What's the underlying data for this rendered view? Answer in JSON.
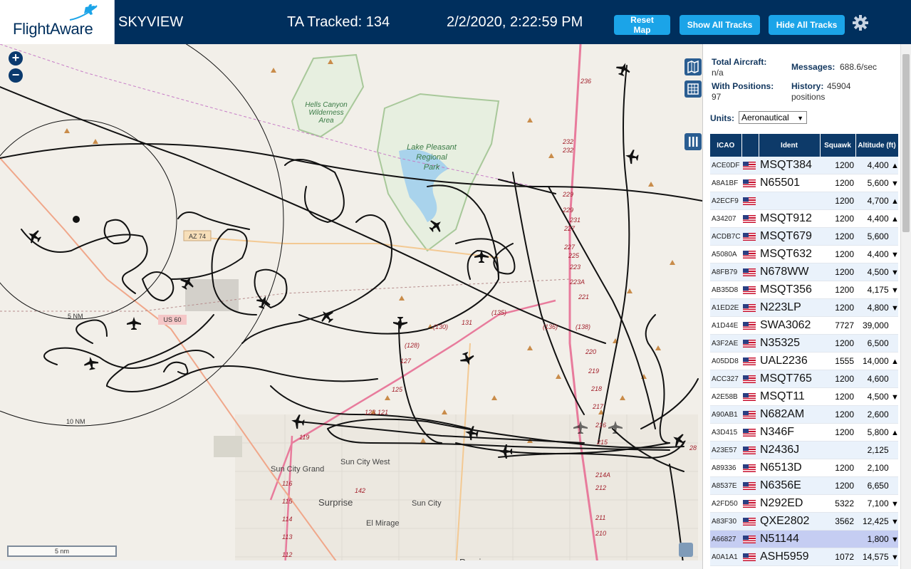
{
  "header": {
    "logo_text": "FlightAware",
    "title": "SKYVIEW",
    "tracked": "TA Tracked: 134",
    "datetime": "2/2/2020, 2:22:59 PM",
    "reset_label": "Reset Map",
    "show_label": "Show All Tracks",
    "hide_label": "Hide All Tracks",
    "icons": {
      "gear": "gear-icon"
    },
    "colors": {
      "bar": "#002f5d",
      "button": "#1ba4e8"
    }
  },
  "map": {
    "zoom_in": "+",
    "zoom_out": "−",
    "scale_label": "5 nm",
    "labels": {
      "hells_canyon": "Hells Canyon",
      "wilderness": "Wilderness",
      "area": "Area",
      "lake_pleasant": "Lake Pleasant",
      "regional": "Regional",
      "park": "Park",
      "az74": "AZ 74",
      "five_nm": "5 NM",
      "ten_nm": "10 NM",
      "sun_city_grand": "Sun City Grand",
      "sun_city_west": "Sun City West",
      "surprise": "Surprise",
      "sun_city": "Sun City",
      "el_mirage": "El Mirage",
      "peoria": "Peoria",
      "us60": "US 60"
    },
    "road_numbers": [
      "236",
      "232",
      "232",
      "229",
      "229",
      "227",
      "227",
      "225",
      "223",
      "223A",
      "221",
      "(138)",
      "(136)",
      "(135)",
      "(130)",
      "131",
      "(128)",
      "127",
      "125",
      "123",
      "121",
      "119",
      "116",
      "115",
      "114",
      "113",
      "112",
      "142",
      "220",
      "219",
      "218",
      "217",
      "216",
      "215",
      "214A",
      "212",
      "211",
      "210",
      "28",
      "231"
    ],
    "controls": [
      "map-layers-icon",
      "grid-icon",
      "columns-icon"
    ]
  },
  "panel": {
    "total_aircraft_label": "Total Aircraft:",
    "total_aircraft_value": "n/a",
    "with_positions_label": "With Positions:",
    "with_positions_value": "97",
    "messages_label": "Messages:",
    "messages_value": "688.6/sec",
    "history_label": "History:",
    "history_value": "45904",
    "history_unit": "positions",
    "units_label": "Units:",
    "units_value": "Aeronautical",
    "columns": [
      "ICAO",
      "Ident",
      "Squawk",
      "Altitude (ft)"
    ],
    "rows": [
      {
        "icao": "ACE0DF",
        "ident": "MSQT384",
        "squawk": "1200",
        "alt": "4,400",
        "trend": "▲"
      },
      {
        "icao": "A8A1BF",
        "ident": "N65501",
        "squawk": "1200",
        "alt": "5,600",
        "trend": "▼"
      },
      {
        "icao": "A2ECF9",
        "ident": "",
        "squawk": "1200",
        "alt": "4,700",
        "trend": "▲"
      },
      {
        "icao": "A34207",
        "ident": "MSQT912",
        "squawk": "1200",
        "alt": "4,400",
        "trend": "▲"
      },
      {
        "icao": "ACDB7C",
        "ident": "MSQT679",
        "squawk": "1200",
        "alt": "5,600",
        "trend": ""
      },
      {
        "icao": "A5080A",
        "ident": "MSQT632",
        "squawk": "1200",
        "alt": "4,400",
        "trend": "▼"
      },
      {
        "icao": "A8FB79",
        "ident": "N678WW",
        "squawk": "1200",
        "alt": "4,500",
        "trend": "▼"
      },
      {
        "icao": "AB35D8",
        "ident": "MSQT356",
        "squawk": "1200",
        "alt": "4,175",
        "trend": "▼"
      },
      {
        "icao": "A1ED2E",
        "ident": "N223LP",
        "squawk": "1200",
        "alt": "4,800",
        "trend": "▼"
      },
      {
        "icao": "A1D44E",
        "ident": "SWA3062",
        "squawk": "7727",
        "alt": "39,000",
        "trend": ""
      },
      {
        "icao": "A3F2AE",
        "ident": "N35325",
        "squawk": "1200",
        "alt": "6,500",
        "trend": ""
      },
      {
        "icao": "A05DD8",
        "ident": "UAL2236",
        "squawk": "1555",
        "alt": "14,000",
        "trend": "▲"
      },
      {
        "icao": "ACC327",
        "ident": "MSQT765",
        "squawk": "1200",
        "alt": "4,600",
        "trend": ""
      },
      {
        "icao": "A2E58B",
        "ident": "MSQT11",
        "squawk": "1200",
        "alt": "4,500",
        "trend": "▼"
      },
      {
        "icao": "A90AB1",
        "ident": "N682AM",
        "squawk": "1200",
        "alt": "2,600",
        "trend": ""
      },
      {
        "icao": "A3D415",
        "ident": "N346F",
        "squawk": "1200",
        "alt": "5,800",
        "trend": "▲"
      },
      {
        "icao": "A23E57",
        "ident": "N2436J",
        "squawk": "",
        "alt": "2,125",
        "trend": ""
      },
      {
        "icao": "A89336",
        "ident": "N6513D",
        "squawk": "1200",
        "alt": "2,100",
        "trend": ""
      },
      {
        "icao": "A8537E",
        "ident": "N6356E",
        "squawk": "1200",
        "alt": "6,650",
        "trend": ""
      },
      {
        "icao": "A2FD50",
        "ident": "N292ED",
        "squawk": "5322",
        "alt": "7,100",
        "trend": "▼"
      },
      {
        "icao": "A83F30",
        "ident": "QXE2802",
        "squawk": "3562",
        "alt": "12,425",
        "trend": "▼"
      },
      {
        "icao": "A66827",
        "ident": "N51144",
        "squawk": "",
        "alt": "1,800",
        "trend": "▼"
      },
      {
        "icao": "A0A1A1",
        "ident": "ASH5959",
        "squawk": "1072",
        "alt": "14,575",
        "trend": "▼"
      }
    ]
  }
}
